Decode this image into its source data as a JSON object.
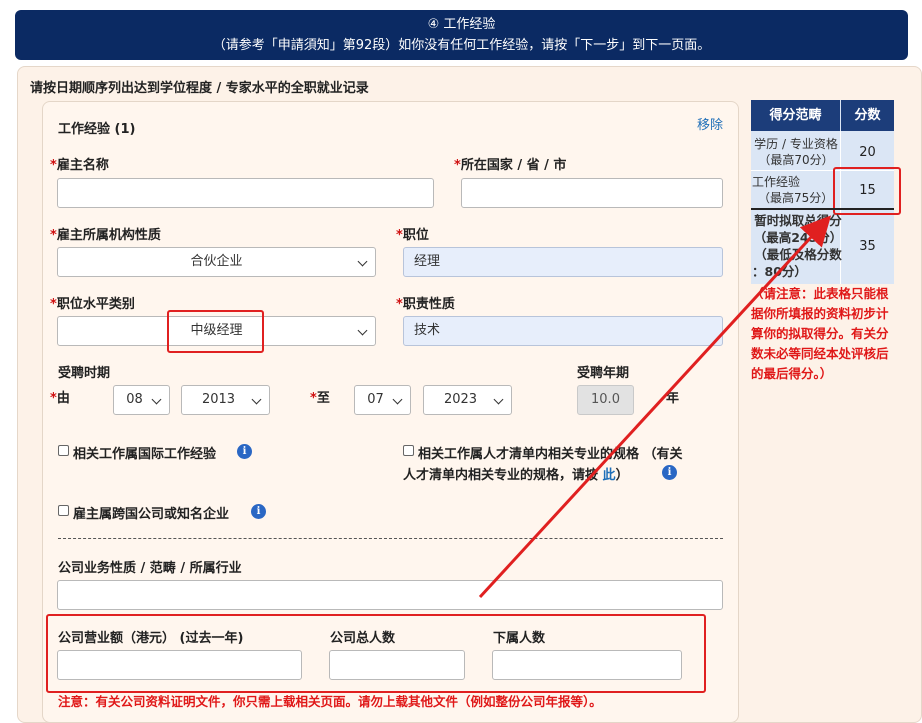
{
  "header": {
    "title": "④ 工作经验",
    "subtitle": "（请参考「申請須知」第92段）如你没有任何工作经验，请按「下一步」到下一页面。"
  },
  "instruction": "请按日期顺序列出达到学位程度 / 专家水平的全职就业记录",
  "card": {
    "title": "工作经验 (1)",
    "remove_label": "移除",
    "employer_name": {
      "label": "雇主名称",
      "value": ""
    },
    "country": {
      "label": "所在国家 / 省 / 市",
      "value": ""
    },
    "org_nature": {
      "label": "雇主所属机构性质",
      "selected": "合伙企业"
    },
    "position": {
      "label": "职位",
      "value": "经理"
    },
    "level": {
      "label": "职位水平类别",
      "selected": "中级经理"
    },
    "duty": {
      "label": "职责性质",
      "value": "技术"
    },
    "period": {
      "label": "受聘时期",
      "from_label": "由",
      "from_month": "08",
      "from_year": "2013",
      "to_label": "至",
      "to_month": "07",
      "to_year": "2023",
      "years_label": "受聘年期",
      "years_value": "10.0",
      "years_unit": "年"
    },
    "checkbox_intl": "相关工作属国际工作经验",
    "checkbox_talent_line1": "相关工作属人才清单内相关专业的规格 （有关",
    "checkbox_talent_line2_pre": "人才清单内相关专业的规格，请按",
    "checkbox_talent_link": "此",
    "checkbox_talent_line2_post": "）",
    "checkbox_mnc": "雇主属跨国公司或知名企业",
    "info_glyph": "i",
    "business_label": "公司业务性质 / 范畴 / 所属行业",
    "business_value": "",
    "turnover_label": "公司营业额（港元） (过去一年)",
    "turnover_value": "",
    "staff_label": "公司总人数",
    "staff_value": "",
    "subordinates_label": "下属人数",
    "subordinates_value": "",
    "bottom_note": "注意：有关公司资料证明文件，你只需上载相关页面。请勿上载其他文件（例如整份公司年报等）。"
  },
  "score_table": {
    "col1": "得分范畴",
    "col2": "分数",
    "rows": [
      {
        "line1": "学历 / 专业资格",
        "line2": "（最高70分）",
        "score": "20"
      },
      {
        "line1": "工作经验",
        "line2": "（最高75分）",
        "score": "15"
      }
    ],
    "total_line1": "暂时拟取总得分",
    "total_line2": "（最高245分）",
    "total_line3": "（最低及格分数",
    "total_line4": "：80分）",
    "total_score": "35",
    "note": "（请注意：此表格只能根据你所填报的资料初步计算你的拟取得分。有关分数未必等同经本处评核后的最后得分。）"
  },
  "colors": {
    "header_bg": "#0b2a63",
    "annotation_red": "#e02020",
    "table_header": "#1c3d7a"
  }
}
